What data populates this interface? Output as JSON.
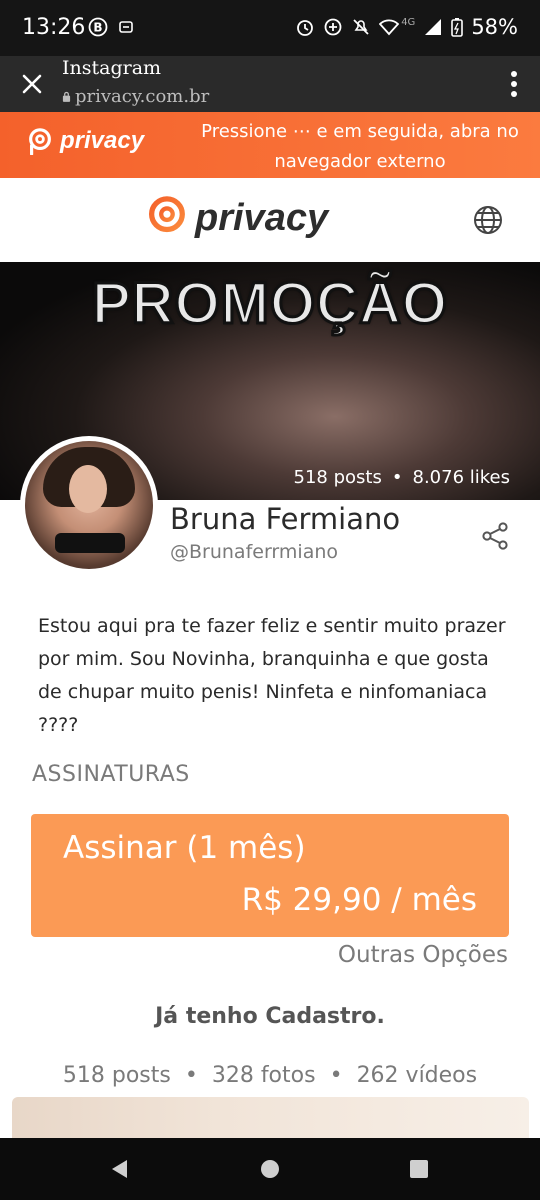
{
  "status_bar": {
    "time": "13:26",
    "network": "4G",
    "battery": "58%"
  },
  "browser": {
    "app_title": "Instagram",
    "url": "privacy.com.br"
  },
  "banner": {
    "logo_text": "privacy",
    "message": "Pressione ⋯ e em seguida, abra no navegador externo"
  },
  "header": {
    "logo_text": "privacy"
  },
  "cover": {
    "overlay_text": "PROMOÇÃO",
    "posts": "518 posts",
    "likes": "8.076 likes"
  },
  "profile": {
    "name": "Bruna Fermiano",
    "handle": "@Brunaferrmiano",
    "bio": "Estou aqui pra te fazer feliz e sentir muito prazer por mim. Sou Novinha, branquinha e que gosta de chupar muito penis! Ninfeta e ninfomaniaca ????"
  },
  "subscriptions": {
    "heading": "ASSINATURAS",
    "plan_label": "Assinar (1 mês)",
    "plan_price": "R$ 29,90 / mês",
    "other_options": "Outras Opções"
  },
  "login": {
    "label": "Já tenho Cadastro."
  },
  "media_counts": {
    "posts": "518 posts",
    "photos": "328 fotos",
    "videos": "262 vídeos"
  },
  "colors": {
    "brand_orange": "#f4612b",
    "button_orange": "#fb9a55",
    "text_dark": "#2b2b2b",
    "text_muted": "#7a7a7a"
  },
  "icons": {
    "statusbar": [
      "b-icon",
      "dnd-icon",
      "alarm-icon",
      "data-saver-icon",
      "mute-icon",
      "wifi-icon",
      "signal-icon",
      "battery-icon"
    ],
    "browser": [
      "close-icon",
      "lock-icon",
      "more-vert-icon"
    ],
    "header": [
      "globe-icon"
    ],
    "profile": [
      "share-icon"
    ],
    "navbar": [
      "back-icon",
      "home-icon",
      "recents-icon"
    ]
  }
}
